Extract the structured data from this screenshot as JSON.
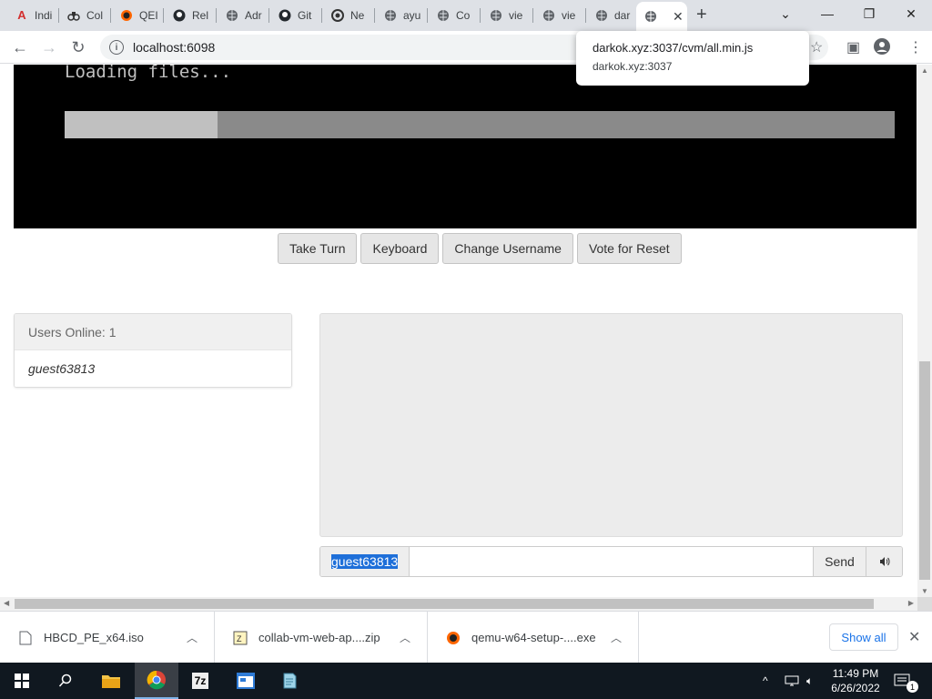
{
  "browser": {
    "tabs": [
      {
        "title": "Indi",
        "icon": "red-a-icon"
      },
      {
        "title": "Col",
        "icon": "binoculars-icon"
      },
      {
        "title": "QEI",
        "icon": "qemu-icon"
      },
      {
        "title": "Rel",
        "icon": "github-icon"
      },
      {
        "title": "Adr",
        "icon": "globe-icon"
      },
      {
        "title": "Git",
        "icon": "github-icon"
      },
      {
        "title": "Ne",
        "icon": "chrome-icon"
      },
      {
        "title": "ayu",
        "icon": "globe-icon"
      },
      {
        "title": "Co",
        "icon": "globe-icon"
      },
      {
        "title": "vie",
        "icon": "globe-icon"
      },
      {
        "title": "vie",
        "icon": "globe-icon"
      },
      {
        "title": "dar",
        "icon": "globe-icon"
      }
    ],
    "active_tab_icon": "globe-icon",
    "url": "localhost:6098",
    "tooltip": {
      "line1": "darkok.xyz:3037/cvm/all.min.js",
      "line2": "darkok.xyz:3037"
    }
  },
  "vm": {
    "loading_text": "Loading files...",
    "progress_fraction": 0.184
  },
  "buttons": {
    "take_turn": "Take Turn",
    "keyboard": "Keyboard",
    "change_username": "Change Username",
    "vote_reset": "Vote for Reset"
  },
  "users": {
    "header": "Users Online: 1",
    "list": [
      "guest63813"
    ]
  },
  "chat": {
    "username": "guest63813",
    "input_value": "",
    "send_label": "Send"
  },
  "downloads": {
    "items": [
      {
        "name": "HBCD_PE_x64.iso"
      },
      {
        "name": "collab-vm-web-ap....zip"
      },
      {
        "name": "qemu-w64-setup-....exe"
      }
    ],
    "show_all": "Show all"
  },
  "taskbar": {
    "time": "11:49 PM",
    "date": "6/26/2022",
    "notification_count": "1",
    "seven_zip_label": "7z"
  },
  "colors": {
    "accent": "#1a73e8",
    "selection": "#1e6fd9",
    "taskbar": "#101820"
  }
}
